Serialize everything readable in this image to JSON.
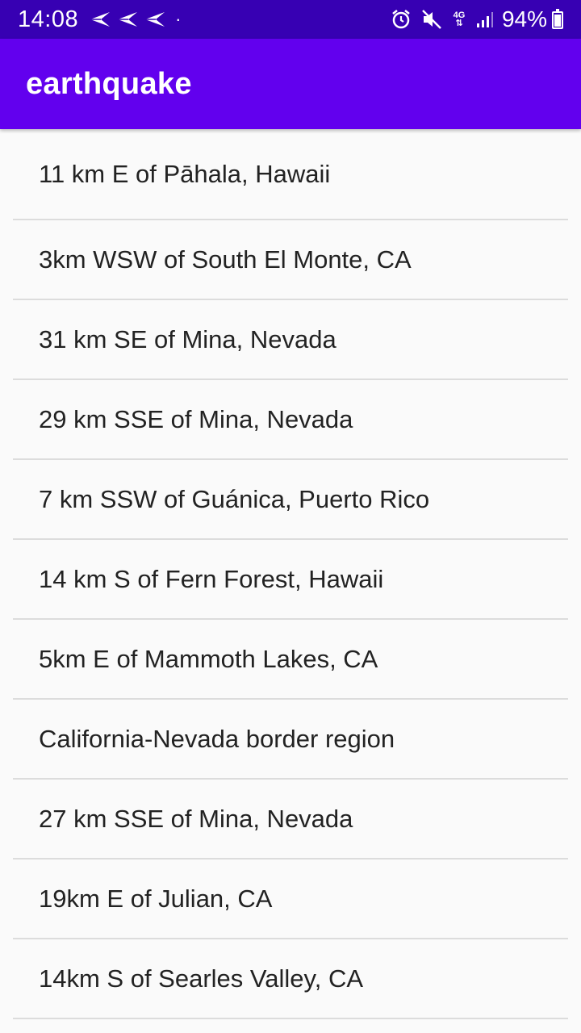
{
  "status_bar": {
    "time": "14:08",
    "network": "4G",
    "battery_percent": "94%"
  },
  "app_bar": {
    "title": "earthquake"
  },
  "earthquakes": [
    "11 km E of Pāhala, Hawaii",
    "3km WSW of South El Monte, CA",
    "31 km SE of Mina, Nevada",
    "29 km SSE of Mina, Nevada",
    "7 km SSW of Guánica, Puerto Rico",
    "14 km S of Fern Forest, Hawaii",
    "5km E of Mammoth Lakes, CA",
    "California-Nevada border region",
    "27 km SSE of Mina, Nevada",
    "19km E of Julian, CA",
    "14km S of Searles Valley, CA"
  ],
  "colors": {
    "status_bar": "#3700b3",
    "app_bar": "#6200ee",
    "background": "#fafafa",
    "divider": "#dcdcdc",
    "text": "#222222"
  },
  "icons": [
    "send-icon",
    "send-icon",
    "send-icon",
    "alarm-icon",
    "mute-icon",
    "signal-icon",
    "battery-icon"
  ]
}
